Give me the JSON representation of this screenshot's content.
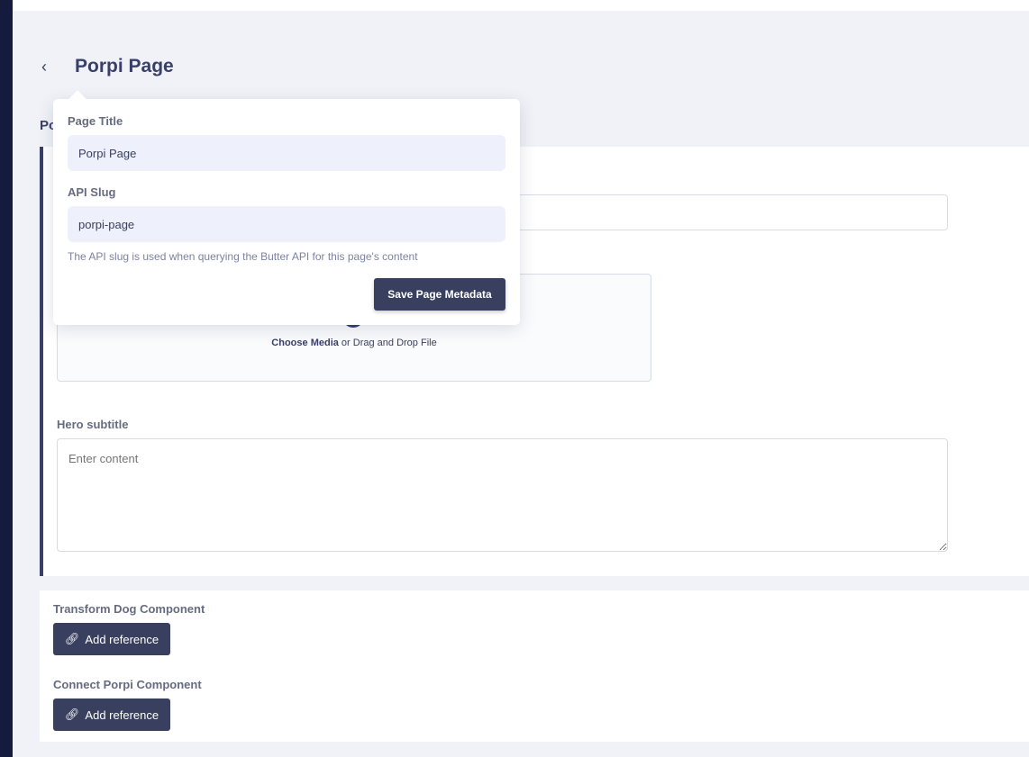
{
  "header": {
    "back_icon": "chevron-left-icon",
    "title": "Porpi Page",
    "section_label": "Po"
  },
  "media": {
    "choose": "Choose Media",
    "rest": " or Drag and Drop File"
  },
  "hero_subtitle": {
    "label": "Hero subtitle",
    "placeholder": "Enter content"
  },
  "references": [
    {
      "label": "Transform Dog Component",
      "button": "Add reference",
      "icon": "link-icon"
    },
    {
      "label": "Connect Porpi Component",
      "button": "Add reference",
      "icon": "link-icon"
    }
  ],
  "popover": {
    "page_title_label": "Page Title",
    "page_title_value": "Porpi Page",
    "slug_label": "API Slug",
    "slug_value": "porpi-page",
    "help": "The API slug is used when querying the Butter API for this page's content",
    "save": "Save Page Metadata"
  }
}
